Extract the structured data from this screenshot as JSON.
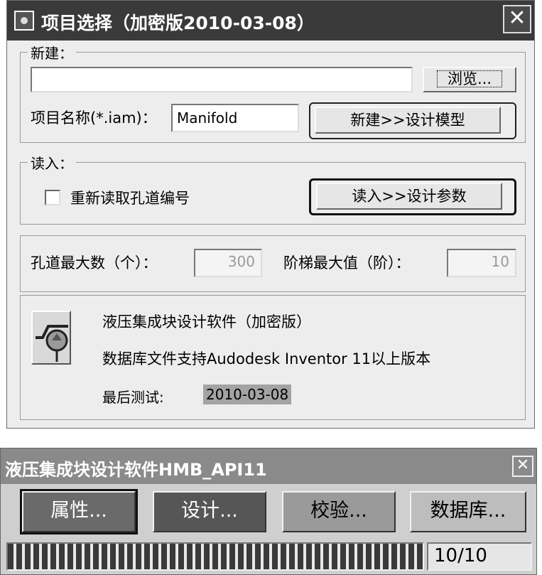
{
  "dialog1": {
    "title": "项目选择（加密版2010-03-08）",
    "close_icon": "close-icon",
    "new_group": {
      "legend": "新建：",
      "path_value": "",
      "browse_label": "浏览...",
      "project_name_label": "项目名称(*.iam)：",
      "project_name_value": "Manifold",
      "new_button_label": "新建>>设计模型"
    },
    "read_group": {
      "legend": "读入：",
      "reread_label": "重新读取孔道编号",
      "reread_checked": false,
      "read_button_label": "读入>>设计参数"
    },
    "params": {
      "max_holes_label": "孔道最大数（个）：",
      "max_holes_value": "300",
      "max_steps_label": "阶梯最大值（阶）：",
      "max_steps_value": "10"
    },
    "about": {
      "logo_icon": "hydraulic-valve-icon",
      "product_line": "液压集成块设计软件（加密版）",
      "support_line": "数据库文件支持Audodesk Inventor 11以上版本",
      "last_test_label": "最后测试:",
      "last_test_date": "2010-03-08"
    }
  },
  "dialog2": {
    "title": "液压集成块设计软件HMB_API11",
    "close_icon": "close-icon",
    "buttons": [
      {
        "label": "属性...",
        "bg": "#6a6a6a",
        "fg": "#ffffff"
      },
      {
        "label": "设计...",
        "bg": "#565656",
        "fg": "#ffffff"
      },
      {
        "label": "校验...",
        "bg": "#9a9a9a",
        "fg": "#000000"
      },
      {
        "label": "数据库...",
        "bg": "#bdbdbd",
        "fg": "#000000"
      }
    ],
    "progress": 1.0,
    "counter": "10/10"
  }
}
